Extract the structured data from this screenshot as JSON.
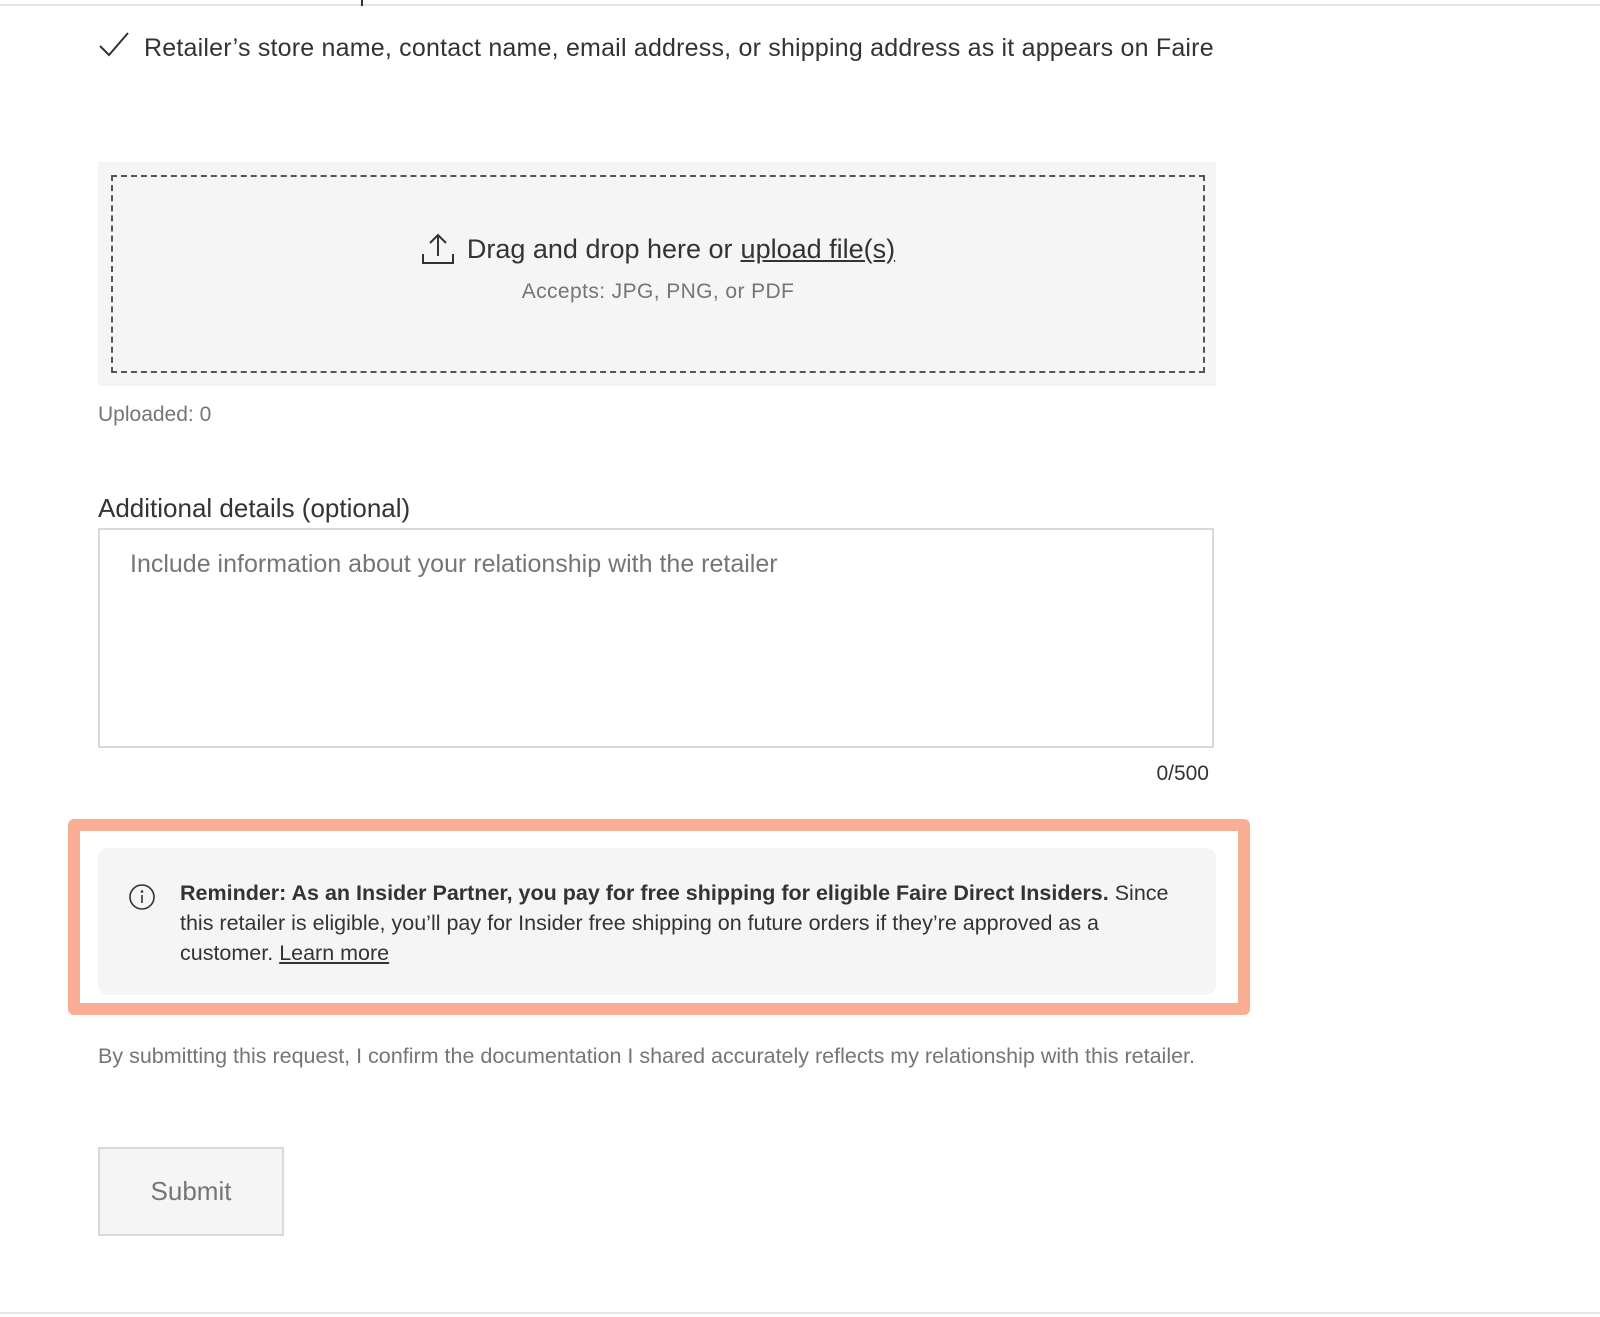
{
  "requirements": {
    "item_text": "Retailer’s store name, contact name, email address, or shipping address as it appears on Faire",
    "icon": "check-icon"
  },
  "upload": {
    "icon": "upload-icon",
    "prompt": "Drag and drop here or",
    "link_label": "upload file(s)",
    "accepts": "Accepts: JPG, PNG, or PDF",
    "uploaded_status": "Uploaded: 0"
  },
  "details": {
    "label": "Additional details (optional)",
    "placeholder": "Include information about your relationship with the retailer",
    "value": "",
    "char_count": "0/500"
  },
  "notice": {
    "icon": "info-icon",
    "bold_text": "Reminder: As an Insider Partner, you pay for free shipping for eligible Faire Direct Insiders.",
    "body_text": "Since this retailer is eligible, you’ll pay for Insider free shipping on future orders if they’re approved as a customer.",
    "link_label": "Learn more",
    "highlight_color": "#f9ad92"
  },
  "disclaimer": "By submitting this request, I confirm the documentation I shared accurately reflects my relationship with this retailer.",
  "submit_label": "Submit",
  "colors": {
    "text": "#333333",
    "muted_text": "#757575",
    "panel_background": "#f5f5f5",
    "border": "#d9d9d9"
  }
}
